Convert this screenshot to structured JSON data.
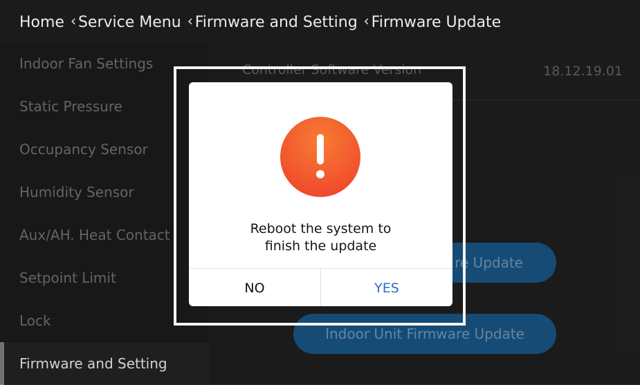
{
  "breadcrumb": {
    "home": "Home",
    "items": [
      "Service Menu",
      "Firmware and Setting",
      "Firmware Update"
    ]
  },
  "sidebar": {
    "items": [
      {
        "label": "Indoor Fan Settings"
      },
      {
        "label": "Static Pressure"
      },
      {
        "label": "Occupancy Sensor"
      },
      {
        "label": "Humidity Sensor"
      },
      {
        "label": "Aux/AH. Heat Contact"
      },
      {
        "label": "Setpoint Limit"
      },
      {
        "label": "Lock"
      },
      {
        "label": "Firmware and Setting"
      }
    ],
    "active_index": 7
  },
  "main": {
    "software_version_label": "Controller Software Version",
    "software_version_value": "18.12.19.01",
    "button1_label": "re Update",
    "button2_label": "Indoor Unit Firmware Update"
  },
  "dialog": {
    "icon": "exclamation-alert-icon",
    "message_line1": "Reboot the system to",
    "message_line2": "finish the update",
    "no_label": "NO",
    "yes_label": "YES"
  },
  "colors": {
    "header_bg": "#1b1b1b",
    "sidebar_bg": "#1e1e1e",
    "button_blue": "#1b5c91",
    "alert_orange": "#f25a2e",
    "yes_blue": "#2b6bc6",
    "focus_frame_red": "#c0161c"
  }
}
